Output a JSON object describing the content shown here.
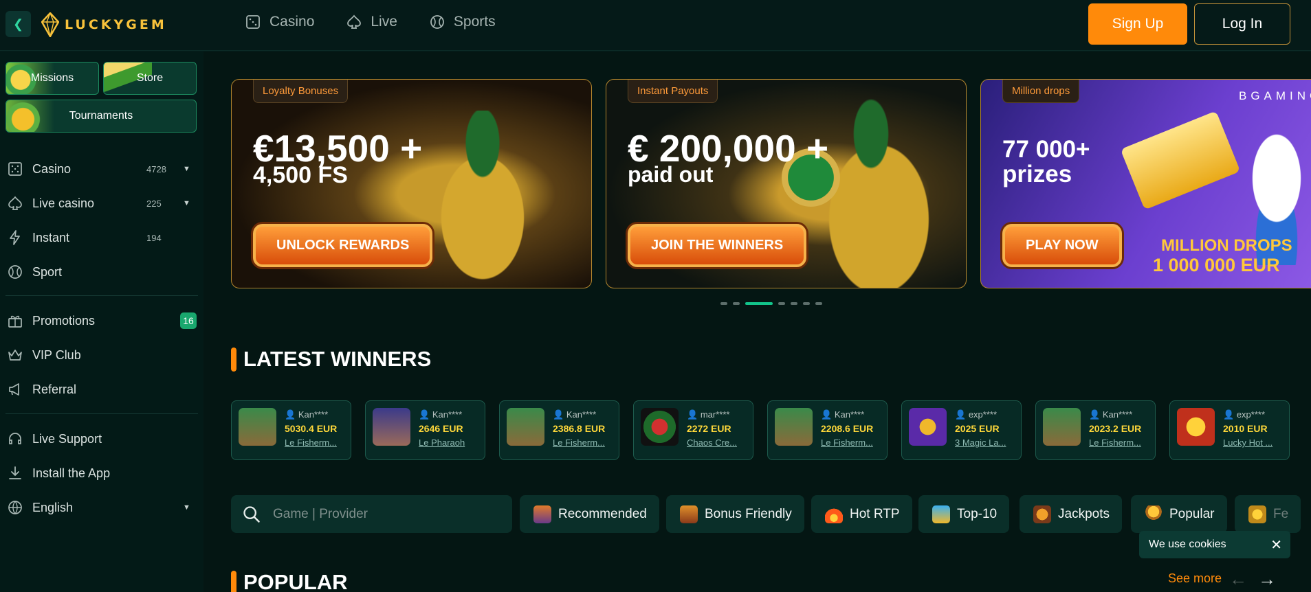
{
  "brand": {
    "name": "LUCKYGEM"
  },
  "topnav": [
    {
      "label": "Casino",
      "icon": "dice-icon"
    },
    {
      "label": "Live",
      "icon": "spade-icon"
    },
    {
      "label": "Sports",
      "icon": "ball-icon"
    }
  ],
  "auth": {
    "signup": "Sign Up",
    "login": "Log In"
  },
  "sidebar": {
    "tiles": [
      {
        "label": "Missions"
      },
      {
        "label": "Store"
      },
      {
        "label": "Tournaments"
      }
    ],
    "items": [
      {
        "label": "Casino",
        "count": "4728",
        "icon": "dice-icon"
      },
      {
        "label": "Live casino",
        "count": "225",
        "icon": "spade-icon"
      },
      {
        "label": "Instant",
        "count": "194",
        "icon": "lightning-icon"
      },
      {
        "label": "Sport",
        "icon": "ball-icon"
      },
      {
        "label": "Promotions",
        "badge": "16",
        "icon": "gift-icon"
      },
      {
        "label": "VIP Club",
        "icon": "crown-icon"
      },
      {
        "label": "Referral",
        "icon": "megaphone-icon"
      },
      {
        "label": "Live Support",
        "icon": "headset-icon"
      },
      {
        "label": "Install the App",
        "icon": "download-icon"
      },
      {
        "label": "English",
        "icon": "globe-icon"
      }
    ]
  },
  "banners": [
    {
      "tag": "Loyalty Bonuses",
      "line1": "€13,500 +",
      "line2": "4,500 FS",
      "button": "UNLOCK REWARDS"
    },
    {
      "tag": "Instant Payouts",
      "line1": "€ 200,000 +",
      "line2": "paid out",
      "button": "JOIN THE WINNERS"
    },
    {
      "tag": "Million drops",
      "line1": "77 000+",
      "line2": "prizes",
      "button": "PLAY NOW",
      "brand": "BGAMING",
      "promo_line1": "MILLION DROPS",
      "promo_line2": "1 000 000 EUR"
    }
  ],
  "latest_winners": {
    "title": "LATEST WINNERS",
    "items": [
      {
        "user": "Kan****",
        "amount": "5030.4 EUR",
        "game": "Le Fisherm..."
      },
      {
        "user": "Kan****",
        "amount": "2646 EUR",
        "game": "Le Pharaoh"
      },
      {
        "user": "Kan****",
        "amount": "2386.8 EUR",
        "game": "Le Fisherm..."
      },
      {
        "user": "mar****",
        "amount": "2272 EUR",
        "game": "Chaos Cre..."
      },
      {
        "user": "Kan****",
        "amount": "2208.6 EUR",
        "game": "Le Fisherm..."
      },
      {
        "user": "exp****",
        "amount": "2025 EUR",
        "game": "3 Magic La..."
      },
      {
        "user": "Kan****",
        "amount": "2023.2 EUR",
        "game": "Le Fisherm..."
      },
      {
        "user": "exp****",
        "amount": "2010 EUR",
        "game": "Lucky Hot ..."
      }
    ]
  },
  "search": {
    "placeholder": "Game | Provider"
  },
  "categories": [
    {
      "label": "Recommended"
    },
    {
      "label": "Bonus Friendly"
    },
    {
      "label": "Hot RTP"
    },
    {
      "label": "Top-10"
    },
    {
      "label": "Jackpots"
    },
    {
      "label": "Popular"
    },
    {
      "label": "Fe"
    }
  ],
  "popular": {
    "title": "POPULAR",
    "see_more": "See more"
  },
  "cookie": {
    "text": "We use cookies"
  },
  "colors": {
    "accent": "#ff8a0a",
    "green": "#12c48a",
    "bg": "#041613",
    "gold": "#ffd83a"
  }
}
